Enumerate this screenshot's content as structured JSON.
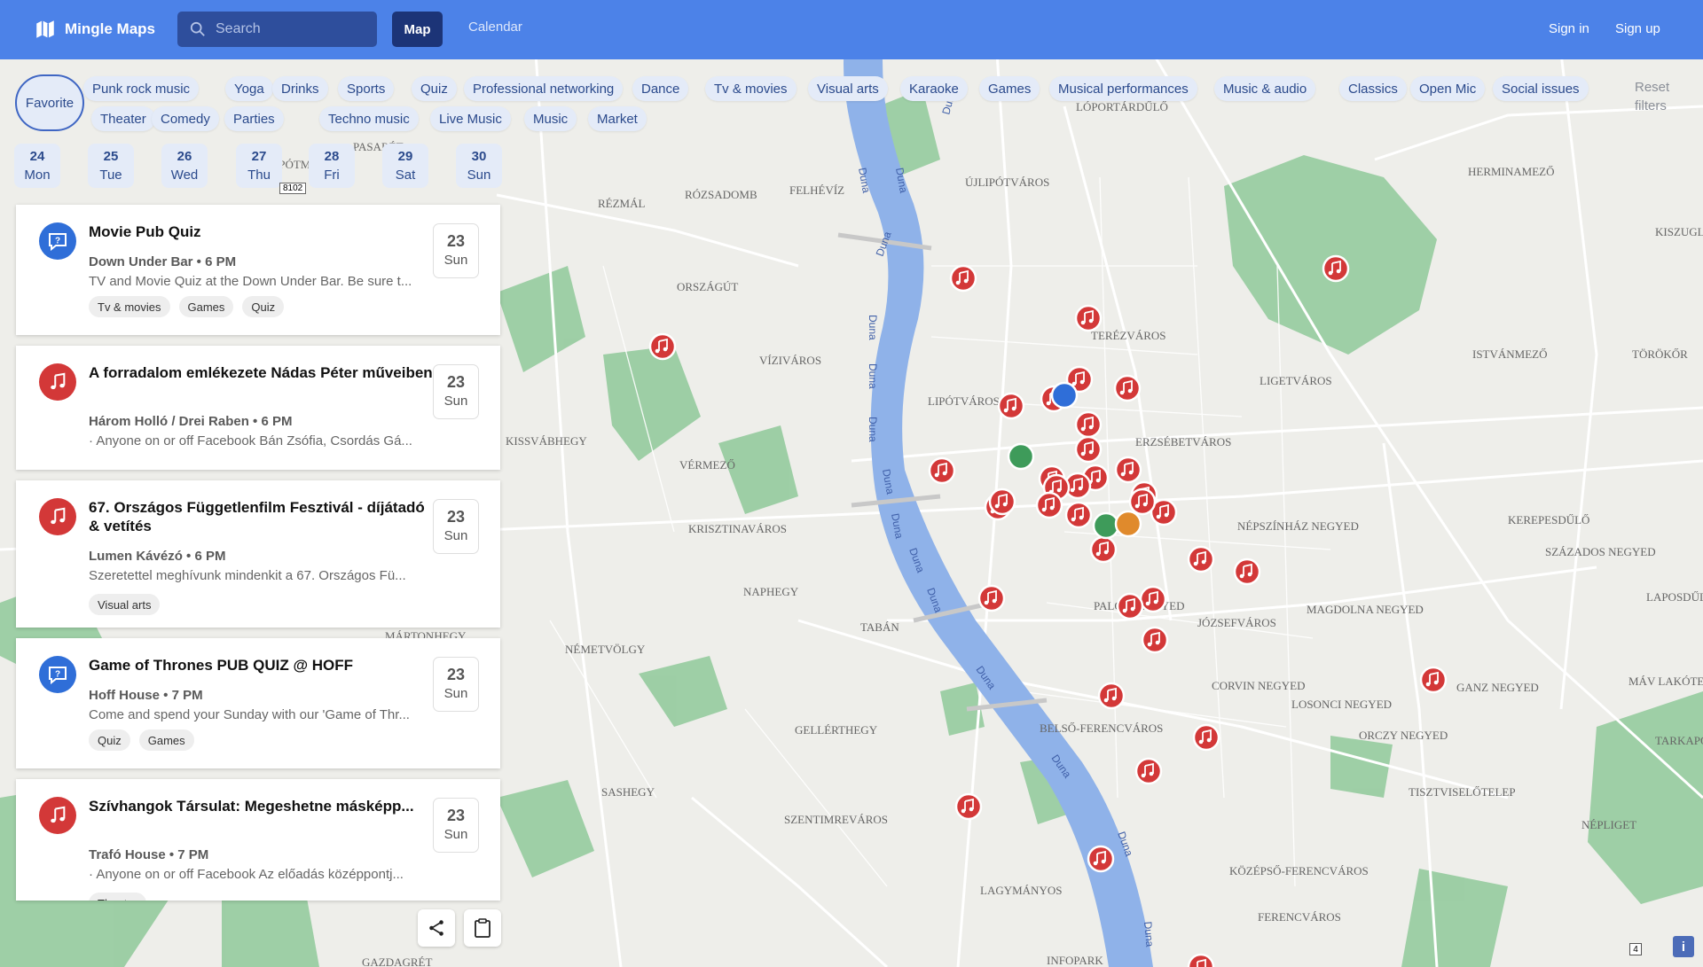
{
  "app": {
    "name": "Mingle Maps"
  },
  "header": {
    "search_placeholder": "Search",
    "nav": {
      "map": "Map",
      "calendar": "Calendar"
    },
    "auth": {
      "sign_in": "Sign in",
      "sign_up": "Sign up"
    }
  },
  "filters": {
    "favorite": "Favorite",
    "reset": "Reset filters",
    "row1": [
      "Punk rock music",
      "Yoga",
      "Drinks",
      "Sports",
      "Quiz",
      "Professional networking",
      "Dance",
      "Tv & movies",
      "Visual arts",
      "Karaoke",
      "Games",
      "Musical performances",
      "Music & audio",
      "Classics",
      "Open Mic",
      "Social issues"
    ],
    "row2": [
      "Theater",
      "Comedy",
      "Parties",
      "Techno music",
      "Live Music",
      "Music",
      "Market"
    ]
  },
  "days": [
    {
      "num": "24",
      "wd": "Mon"
    },
    {
      "num": "25",
      "wd": "Tue"
    },
    {
      "num": "26",
      "wd": "Wed"
    },
    {
      "num": "27",
      "wd": "Thu"
    },
    {
      "num": "28",
      "wd": "Fri"
    },
    {
      "num": "29",
      "wd": "Sat"
    },
    {
      "num": "30",
      "wd": "Sun"
    }
  ],
  "events": [
    {
      "title": "Movie Pub Quiz",
      "venue": "Down Under Bar • 6 PM",
      "desc": "TV and Movie Quiz at the Down Under Bar. Be sure t...",
      "tags": [
        "Tv & movies",
        "Games",
        "Quiz"
      ],
      "date_num": "23",
      "date_wd": "Sun",
      "icon": "quiz-icon",
      "icon_color": "#2f6ed8"
    },
    {
      "title": "A forradalom emlékezete Nádas Péter műveiben",
      "venue": "Három Holló / Drei Raben • 6 PM",
      "desc": " · Anyone on or off Facebook Bán Zsófia, Csordás Gá...",
      "tags": [],
      "date_num": "23",
      "date_wd": "Sun",
      "icon": "music-note-icon",
      "icon_color": "#d33838"
    },
    {
      "title": "67. Országos Függetlenfilm Fesztivál - díjátadó & vetítés",
      "venue": "Lumen Kávézó • 6 PM",
      "desc": "Szeretettel meghívunk mindenkit a 67. Országos Fü...",
      "tags": [
        "Visual arts"
      ],
      "date_num": "23",
      "date_wd": "Sun",
      "icon": "music-note-icon",
      "icon_color": "#d33838"
    },
    {
      "title": "Game of Thrones PUB QUIZ @ HOFF",
      "venue": "Hoff House • 7 PM",
      "desc": "Come and spend your Sunday with our 'Game of Thr...",
      "tags": [
        "Quiz",
        "Games"
      ],
      "date_num": "23",
      "date_wd": "Sun",
      "icon": "quiz-icon",
      "icon_color": "#2f6ed8"
    },
    {
      "title": "Szívhangok Társulat: Megeshetne másképp...",
      "venue": "Trafó House • 7 PM",
      "desc": " · Anyone on or off Facebook Az előadás középpontj...",
      "tags": [
        "Theater"
      ],
      "date_num": "23",
      "date_wd": "Sun",
      "icon": "music-note-icon",
      "icon_color": "#d33838"
    }
  ],
  "map": {
    "road_sign": "8102",
    "zoom_badge": "4",
    "info_button": "i",
    "river_labels": [
      "Duna",
      "Duna",
      "Duna",
      "Duna",
      "Duna",
      "Duna",
      "Duna",
      "Duna",
      "Duna",
      "Duna",
      "Duna",
      "Duna",
      "Duna",
      "Duna",
      "Duna"
    ],
    "district_labels": [
      "LIPÓTVÁROS",
      "TERÉZVÁROS",
      "ERZSÉBETVÁROS",
      "LIGETVÁROS",
      "NÉPSZÍNHÁZ NEGYED",
      "JÓZSEFVÁROS",
      "PALOTANEGYED",
      "MAGDOLNA NEGYED",
      "BELSŐ-FERENCVÁROS",
      "CORVIN NEGYED",
      "LOSONCI NEGYED",
      "ORCZY NEGYED",
      "GANZ NEGYED",
      "TISZTVISELŐTELEP",
      "NÉPLIGET",
      "KÖZÉPSŐ-FERENCVÁROS",
      "FERENCVÁROS",
      "ÚJLIPÓTVÁROS",
      "HERMINAMEZŐ",
      "ISTVÁNMEZŐ",
      "TÖRÖKŐR",
      "KISZUGLÓ",
      "KEREPESDŰLŐ",
      "SZÁZADOS NEGYED",
      "LAPOSDŰLŐ",
      "MÁV LAKÓTELEP",
      "TARKAPOLYS",
      "VÍZIVÁROS",
      "KRISZTINAVÁROS",
      "VÉRMEZŐ",
      "NAPHEGY",
      "TABÁN",
      "GELLÉRTHEGY",
      "SZENTIMREVÁROS",
      "LAGYMÁNYOS",
      "INFOPARK",
      "RÓZSADOMB",
      "FELHÉVÍZ",
      "RÉZMÁL",
      "ORSZÁGÚT",
      "KISSVÁBHEGY",
      "NÉMETVÖLGY",
      "SASHEGY",
      "MÁRTONHEGY",
      "GAZDAGRÉT",
      "LIPÓTMEZŐ",
      "PASARÉT",
      "LÓPORTÁRDŰLŐ"
    ],
    "colors": {
      "water": "#8fb2e9",
      "park": "#8fc99a",
      "land": "#eeeeea",
      "road": "#ffffff",
      "marker_music": "#d33838",
      "marker_quiz": "#2f6ed8",
      "marker_museum": "#3e9b5a",
      "marker_art": "#e08a2c"
    }
  }
}
